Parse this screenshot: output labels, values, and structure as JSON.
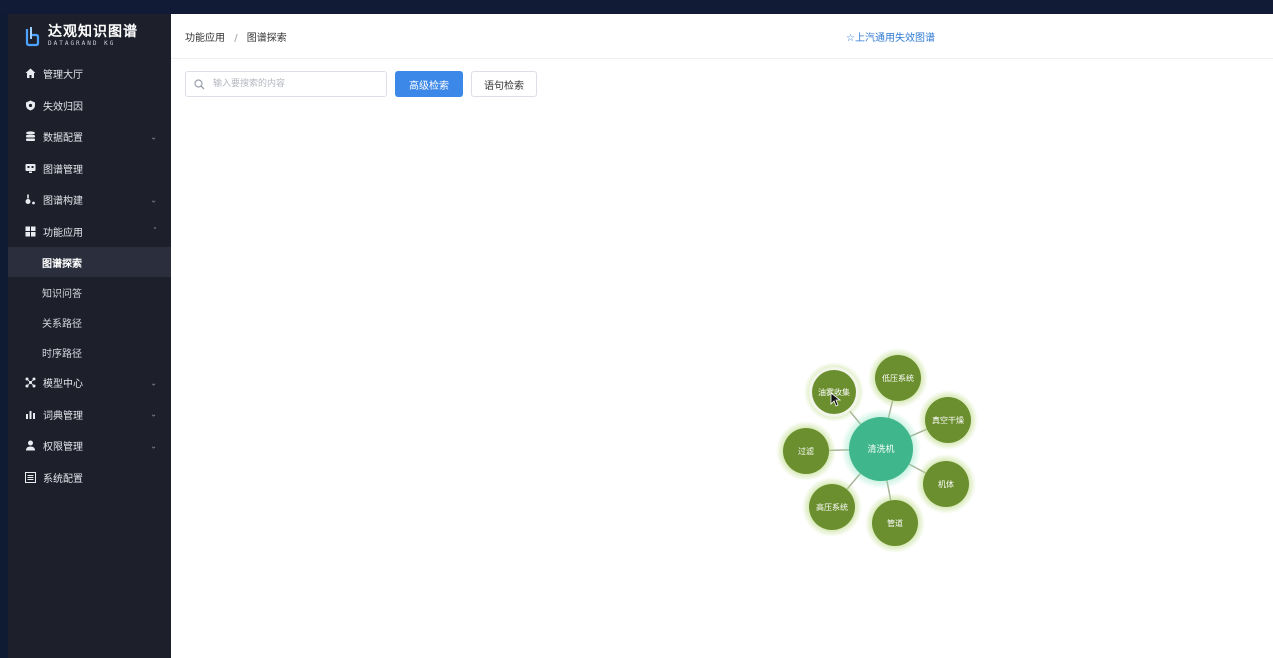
{
  "logo": {
    "title": "达观知识图谱",
    "subtitle": "DATAGRAND KG"
  },
  "sidebar": {
    "items": [
      {
        "label": "管理大厅",
        "icon": "home-icon"
      },
      {
        "label": "失效归因",
        "icon": "shield-icon"
      },
      {
        "label": "数据配置",
        "icon": "database-icon",
        "expandable": true
      },
      {
        "label": "图谱管理",
        "icon": "monitor-icon"
      },
      {
        "label": "图谱构建",
        "icon": "build-icon",
        "expandable": true
      },
      {
        "label": "功能应用",
        "icon": "grid-icon",
        "expanded": true
      },
      {
        "label": "模型中心",
        "icon": "model-icon",
        "expandable": true
      },
      {
        "label": "词典管理",
        "icon": "chart-icon",
        "expandable": true
      },
      {
        "label": "权限管理",
        "icon": "user-icon",
        "expandable": true
      },
      {
        "label": "系统配置",
        "icon": "settings-icon"
      }
    ],
    "sub_items": [
      {
        "label": "图谱探索",
        "active": true
      },
      {
        "label": "知识问答"
      },
      {
        "label": "关系路径"
      },
      {
        "label": "时序路径"
      }
    ]
  },
  "breadcrumb": {
    "parent": "功能应用",
    "separator": "/",
    "current": "图谱探索"
  },
  "kg_title": "☆上汽通用失效图谱",
  "search": {
    "placeholder": "输入要搜索的内容",
    "value": ""
  },
  "buttons": {
    "advanced": "高级检索",
    "sentence": "语句检索"
  },
  "graph": {
    "center": {
      "label": "清洗机"
    },
    "nodes": [
      {
        "label": "油雾收集",
        "highlight": true
      },
      {
        "label": "低压系统"
      },
      {
        "label": "真空干燥"
      },
      {
        "label": "机体"
      },
      {
        "label": "管道"
      },
      {
        "label": "高压系统"
      },
      {
        "label": "过滤"
      }
    ],
    "colors": {
      "center": "#3fb68b",
      "node": "#6b8f2e",
      "glow": "#b6d77a"
    }
  }
}
